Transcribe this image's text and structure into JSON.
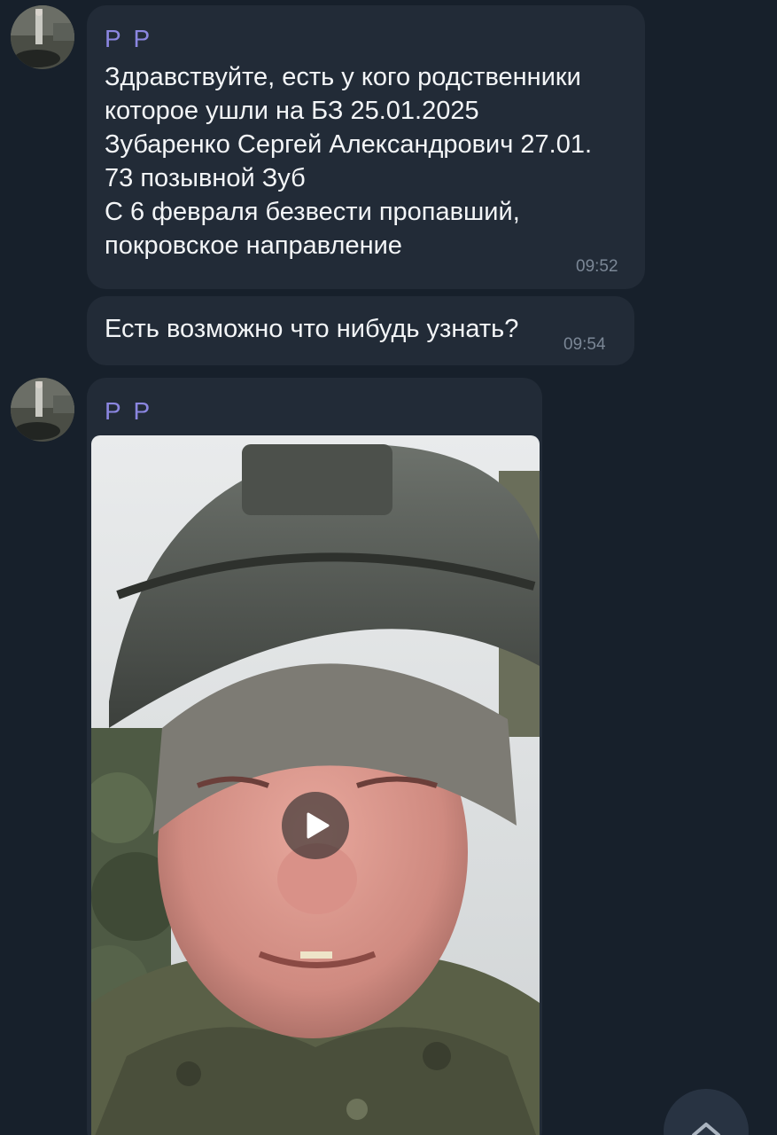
{
  "messages": [
    {
      "sender": "Р Р",
      "text": "Здравствуйте, есть у кого родственники\nкоторое ушли на БЗ 25.01.2025\nЗубаренко Сергей Александрович 27.01.\n73 позывной Зуб\nС 6 февраля безвести пропавший,\nпокровское направление",
      "time": "09:52"
    },
    {
      "text": "Есть возможно что нибудь узнать?",
      "time": "09:54"
    },
    {
      "sender": "Р Р",
      "media": {
        "type": "video",
        "play_icon": "play-icon"
      }
    }
  ],
  "colors": {
    "background": "#17202b",
    "bubble": "#222b37",
    "sender_name": "#8b86e0",
    "time": "#7b8796"
  },
  "icons": {
    "scroll_down": "chevron-up-icon"
  }
}
